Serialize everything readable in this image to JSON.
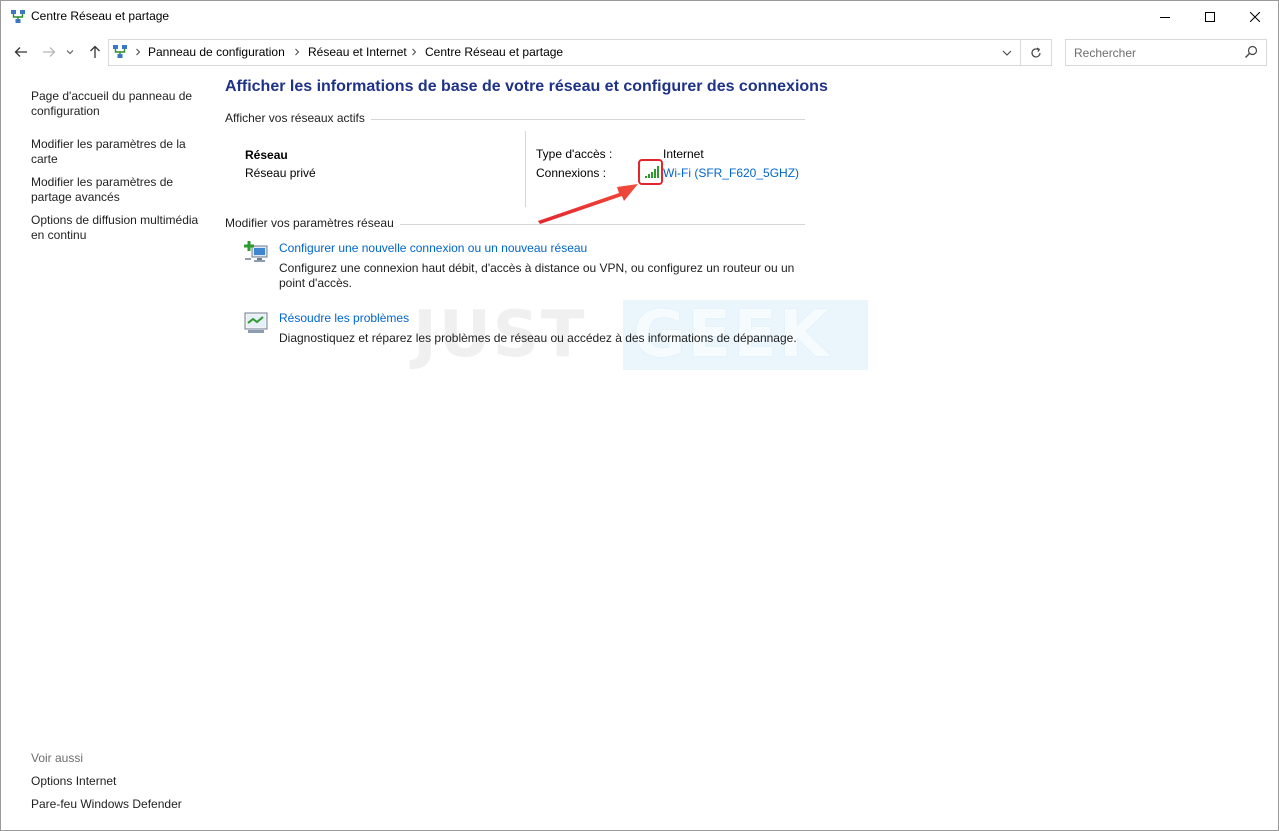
{
  "window": {
    "title": "Centre Réseau et partage"
  },
  "address_bar": {
    "breadcrumbs": [
      "Panneau de configuration",
      "Réseau et Internet",
      "Centre Réseau et partage"
    ],
    "search_placeholder": "Rechercher"
  },
  "left_pane": {
    "links": [
      "Page d'accueil du panneau de configuration",
      "Modifier les paramètres de la carte",
      "Modifier les paramètres de partage avancés",
      "Options de diffusion multimédia en continu"
    ],
    "see_also_label": "Voir aussi",
    "see_also_links": [
      "Options Internet",
      "Pare-feu Windows Defender"
    ]
  },
  "main": {
    "title": "Afficher les informations de base de votre réseau et configurer des connexions",
    "active_networks_heading": "Afficher vos réseaux actifs",
    "network": {
      "name": "Réseau",
      "profile": "Réseau privé",
      "access_type_label": "Type d'accès :",
      "access_type_value": "Internet",
      "connections_label": "Connexions :",
      "connection_name": "Wi-Fi (SFR_F620_5GHZ)"
    },
    "change_settings_heading": "Modifier vos paramètres réseau",
    "tasks": [
      {
        "link": "Configurer une nouvelle connexion ou un nouveau réseau",
        "description": "Configurez une connexion haut débit, d'accès à distance ou VPN, ou configurez un routeur ou un point d'accès."
      },
      {
        "link": "Résoudre les problèmes",
        "description": "Diagnostiquez et réparez les problèmes de réseau ou accédez à des informations de dépannage."
      }
    ]
  },
  "watermark": {
    "part1": "JUST",
    "part2": "GEEK"
  },
  "colors": {
    "title_blue": "#1e3287",
    "link_blue": "#0066cc",
    "annotation_red": "#e3262d",
    "wifi_green": "#2e9a2e"
  }
}
